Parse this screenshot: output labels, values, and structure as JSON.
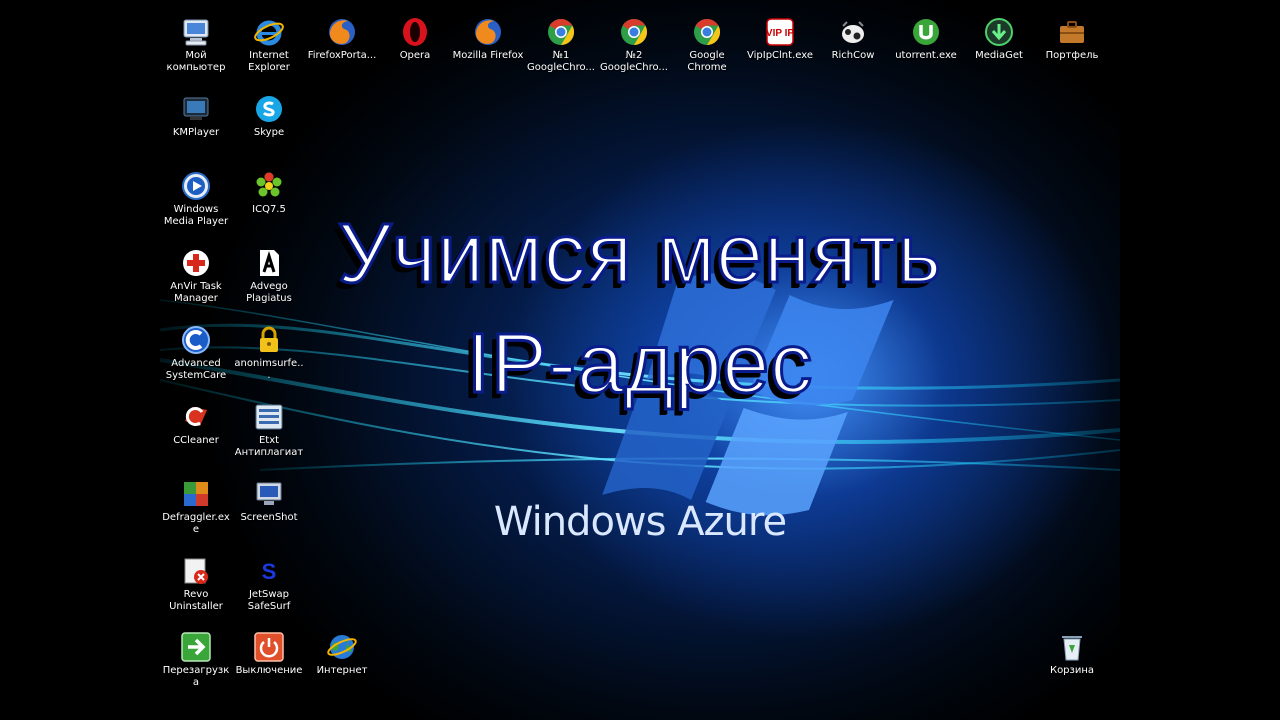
{
  "headline": {
    "line1": "Учимся менять",
    "line2": "IP-адрес"
  },
  "wallpaper": {
    "brand": "Windows Azure",
    "accent": "#1e6cff"
  },
  "icons": {
    "my_computer": "Мой компьютер",
    "ie": "Internet Explorer",
    "firefox_portable": "FirefoxPorta...",
    "opera": "Opera",
    "mozilla_firefox": "Mozilla Firefox",
    "chrome1": "№1 GoogleChro...",
    "chrome2": "№2 GoogleChro...",
    "google_chrome": "Google Chrome",
    "vipip": "VipIpClnt.exe",
    "richcow": "RichCow",
    "utorrent": "utorrent.exe",
    "mediaget": "MediaGet",
    "briefcase": "Портфель",
    "kmplayer": "KMPlayer",
    "skype": "Skype",
    "wmp": "Windows Media Player",
    "icq": "ICQ7.5",
    "anvir": "AnVir Task Manager",
    "advego": "Advego Plagiatus",
    "asc": "Advanced SystemCare",
    "anonimsurf": "anonimsurfe...",
    "ccleaner": "CCleaner",
    "etxt": "Etxt Антиплагиат",
    "defraggler": "Defraggler.exe",
    "screenshot": "ScreenShot",
    "revo": "Revo Uninstaller",
    "jetswap": "JetSwap SafeSurf",
    "reboot": "Перезагрузка",
    "shutdown": "Выключение",
    "internet": "Интернет",
    "recycle": "Корзина",
    "vipip_badge": "VIP IP",
    "jetswap_badge": "S"
  }
}
